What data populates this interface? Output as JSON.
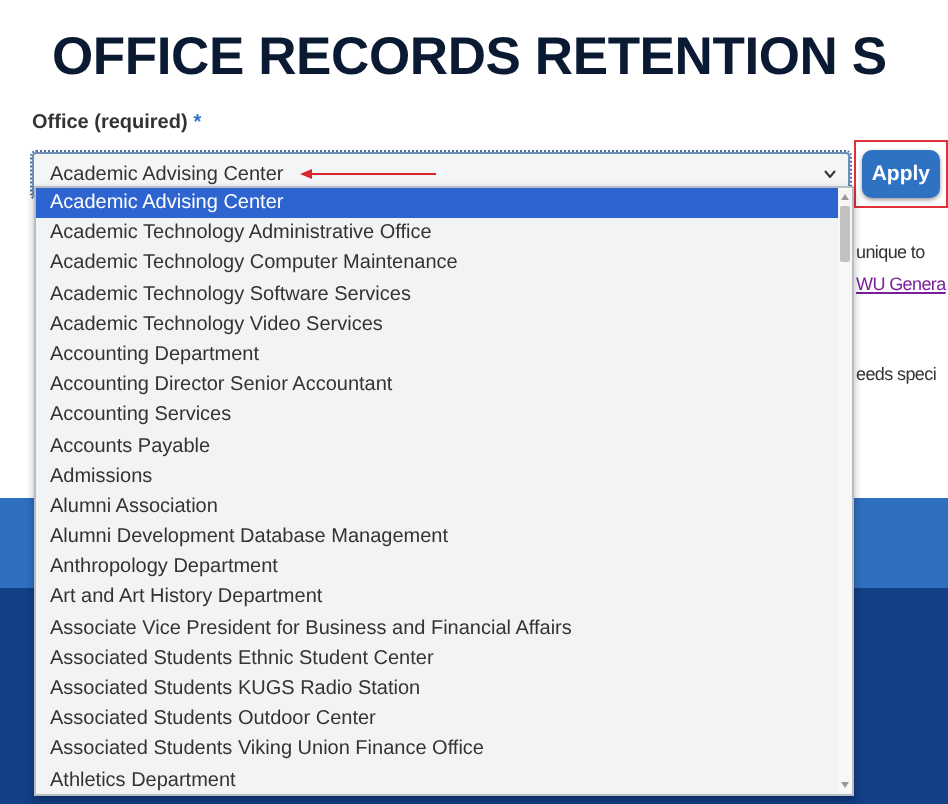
{
  "title": "OFFICE RECORDS RETENTION S",
  "office_field": {
    "label": "Office (required)",
    "required_mark": "*",
    "value": "Academic Advising Center"
  },
  "apply_button": {
    "label": "Apply"
  },
  "background_text": [
    {
      "kind": "text",
      "text": "unique to"
    },
    {
      "kind": "link",
      "text": "WU Genera"
    },
    {
      "kind": "text",
      "text": "eeds speci"
    }
  ],
  "dropdown_options": [
    {
      "label": "Academic Advising Center",
      "selected": true
    },
    {
      "label": "Academic Technology Administrative Office",
      "selected": false
    },
    {
      "label": "Academic Technology Computer Maintenance",
      "selected": false
    },
    {
      "label": "Academic Technology Software Services",
      "selected": false
    },
    {
      "label": "Academic Technology Video Services",
      "selected": false
    },
    {
      "label": "Accounting Department",
      "selected": false
    },
    {
      "label": "Accounting Director Senior Accountant",
      "selected": false
    },
    {
      "label": "Accounting Services",
      "selected": false
    },
    {
      "label": "Accounts Payable",
      "selected": false
    },
    {
      "label": "Admissions",
      "selected": false
    },
    {
      "label": "Alumni Association",
      "selected": false
    },
    {
      "label": "Alumni Development Database Management",
      "selected": false
    },
    {
      "label": "Anthropology Department",
      "selected": false
    },
    {
      "label": "Art and Art History Department",
      "selected": false
    },
    {
      "label": "Associate Vice President for Business and Financial Affairs",
      "selected": false
    },
    {
      "label": "Associated Students Ethnic Student Center",
      "selected": false
    },
    {
      "label": "Associated Students KUGS Radio Station",
      "selected": false
    },
    {
      "label": "Associated Students Outdoor Center",
      "selected": false
    },
    {
      "label": "Associated Students Viking Union Finance Office",
      "selected": false
    },
    {
      "label": "Athletics Department",
      "selected": false
    }
  ]
}
